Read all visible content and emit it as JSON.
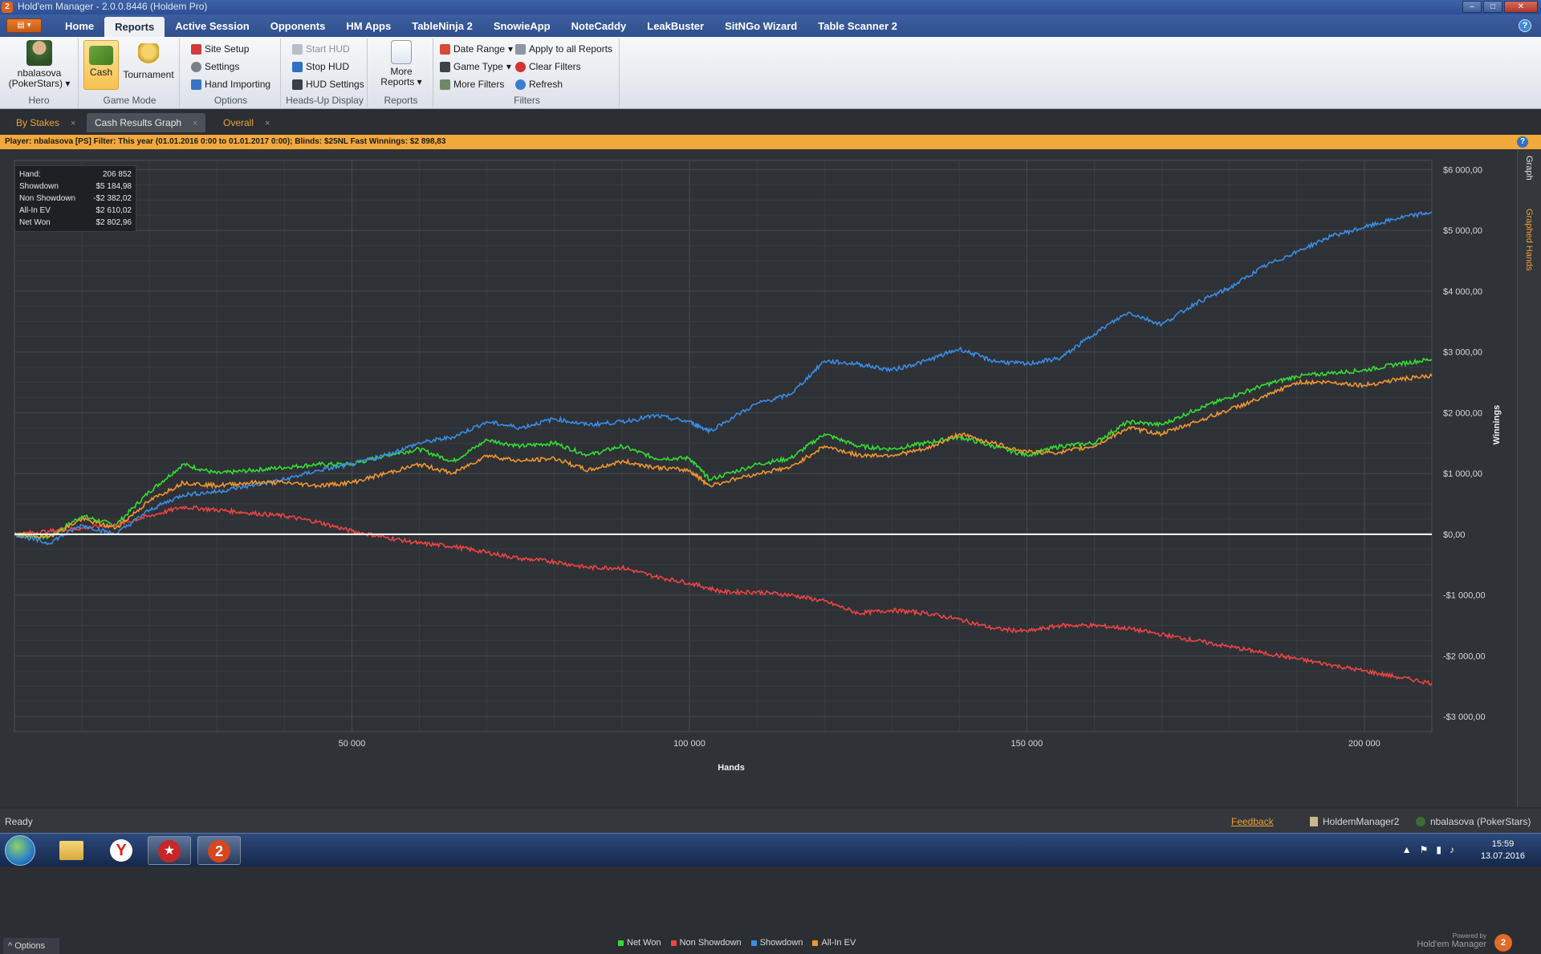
{
  "window": {
    "title": "Hold'em Manager - 2.0.0.8446 (Holdem Pro)"
  },
  "menu": {
    "tabs": [
      "Home",
      "Reports",
      "Active Session",
      "Opponents",
      "HM Apps",
      "TableNinja 2",
      "SnowieApp",
      "NoteCaddy",
      "LeakBuster",
      "SitNGo Wizard",
      "Table Scanner 2"
    ],
    "active": "Reports",
    "help": "?"
  },
  "ribbon": {
    "hero": {
      "name": "nbalasova",
      "site": "(PokerStars)",
      "label": "Hero"
    },
    "game_mode": {
      "cash": "Cash",
      "tournament": "Tournament",
      "label": "Game Mode"
    },
    "options": {
      "site_setup": "Site Setup",
      "settings": "Settings",
      "hand_importing": "Hand Importing",
      "label": "Options"
    },
    "hud": {
      "start": "Start HUD",
      "stop": "Stop HUD",
      "settings": "HUD Settings",
      "label": "Heads-Up Display"
    },
    "reports": {
      "more_line1": "More",
      "more_line2": "Reports",
      "label": "Reports"
    },
    "filters": {
      "date_range": "Date Range",
      "game_type": "Game Type",
      "more_filters": "More Filters",
      "apply_all": "Apply to all Reports",
      "clear": "Clear Filters",
      "refresh": "Refresh",
      "label": "Filters"
    }
  },
  "doc_tabs": [
    {
      "label": "By Stakes",
      "close": "×"
    },
    {
      "label": "Cash Results Graph",
      "close": "×"
    },
    {
      "label": "Overall",
      "close": "×"
    }
  ],
  "filter_bar": {
    "text": "Player:  nbalasova [PS]  Filter:  This year (01.01.2016 0:00 to 01.01.2017 0:00); Blinds: $25NL Fast  Winnings:  $2 898,83",
    "help": "?"
  },
  "stats": [
    {
      "label": "Hand:",
      "value": "206 852"
    },
    {
      "label": "Showdown",
      "value": "$5 184,98"
    },
    {
      "label": "Non Showdown",
      "value": "-$2 382,02"
    },
    {
      "label": "All-In EV",
      "value": "$2 610,02"
    },
    {
      "label": "Net Won",
      "value": "$2 802,96"
    }
  ],
  "side_panel": {
    "graph": "Graph",
    "graphed_hands": "Graphed Hands"
  },
  "options_button": "^ Options",
  "powered_by": {
    "small": "Powered by",
    "name": "Hold'em Manager",
    "logo": "2"
  },
  "status": {
    "ready": "Ready",
    "feedback": "Feedback",
    "database": "HoldemManager2",
    "player": "nbalasova (PokerStars)"
  },
  "taskbar": {
    "time": "15:59",
    "date": "13.07.2016"
  },
  "colors": {
    "net_won": "#33dd33",
    "non_showdown": "#ee4444",
    "showdown": "#3a8ee6",
    "all_in_ev": "#f0962e",
    "accent": "#f2a93b"
  },
  "chart_data": {
    "type": "line",
    "xlabel": "Hands",
    "ylabel": "Winnings",
    "xlim": [
      0,
      210000
    ],
    "ylim": [
      -3250,
      6150
    ],
    "x_ticks": [
      {
        "value": 50000,
        "label": "50 000"
      },
      {
        "value": 100000,
        "label": "100 000"
      },
      {
        "value": 150000,
        "label": "150 000"
      },
      {
        "value": 200000,
        "label": "200 000"
      }
    ],
    "y_ticks": [
      {
        "value": 6000,
        "label": "$6 000,00"
      },
      {
        "value": 5000,
        "label": "$5 000,00"
      },
      {
        "value": 4000,
        "label": "$4 000,00"
      },
      {
        "value": 3000,
        "label": "$3 000,00"
      },
      {
        "value": 2000,
        "label": "$2 000,00"
      },
      {
        "value": 1000,
        "label": "$1 000,00"
      },
      {
        "value": 0,
        "label": "$0,00"
      },
      {
        "value": -1000,
        "label": "-$1 000,00"
      },
      {
        "value": -2000,
        "label": "-$2 000,00"
      },
      {
        "value": -3000,
        "label": "-$3 000,00"
      }
    ],
    "legend_position": "bottom-center",
    "grid": true,
    "series": [
      {
        "name": "Net Won",
        "color": "#33dd33",
        "x": [
          0,
          5000,
          10000,
          15000,
          20000,
          25000,
          30000,
          35000,
          40000,
          45000,
          50000,
          55000,
          60000,
          65000,
          70000,
          75000,
          80000,
          85000,
          90000,
          95000,
          100000,
          103000,
          110000,
          115000,
          120000,
          125000,
          130000,
          135000,
          140000,
          145000,
          150000,
          155000,
          160000,
          165000,
          170000,
          175000,
          180000,
          185000,
          190000,
          195000,
          200000,
          205000,
          210000
        ],
        "y": [
          0,
          -50,
          300,
          150,
          700,
          1150,
          1000,
          1050,
          1100,
          1150,
          1150,
          1300,
          1400,
          1200,
          1550,
          1450,
          1500,
          1300,
          1450,
          1250,
          1250,
          900,
          1150,
          1250,
          1650,
          1450,
          1400,
          1500,
          1600,
          1450,
          1300,
          1450,
          1500,
          1850,
          1800,
          2050,
          2250,
          2450,
          2600,
          2650,
          2700,
          2800,
          2880
        ]
      },
      {
        "name": "Non Showdown",
        "color": "#ee4444",
        "x": [
          0,
          5000,
          10000,
          15000,
          20000,
          25000,
          30000,
          35000,
          40000,
          45000,
          50000,
          55000,
          60000,
          65000,
          70000,
          75000,
          80000,
          85000,
          90000,
          95000,
          100000,
          105000,
          110000,
          115000,
          120000,
          125000,
          130000,
          135000,
          140000,
          145000,
          150000,
          155000,
          160000,
          165000,
          170000,
          175000,
          180000,
          185000,
          190000,
          195000,
          200000,
          205000,
          210000
        ],
        "y": [
          0,
          50,
          100,
          150,
          300,
          450,
          400,
          350,
          300,
          200,
          50,
          -50,
          -150,
          -200,
          -300,
          -400,
          -450,
          -550,
          -550,
          -700,
          -800,
          -950,
          -950,
          -1000,
          -1100,
          -1300,
          -1250,
          -1300,
          -1400,
          -1550,
          -1600,
          -1500,
          -1500,
          -1550,
          -1650,
          -1750,
          -1850,
          -1950,
          -2050,
          -2150,
          -2250,
          -2350,
          -2450
        ]
      },
      {
        "name": "Showdown",
        "color": "#3a8ee6",
        "x": [
          0,
          5000,
          10000,
          15000,
          20000,
          25000,
          30000,
          35000,
          40000,
          45000,
          50000,
          55000,
          60000,
          65000,
          70000,
          75000,
          80000,
          85000,
          90000,
          95000,
          100000,
          103000,
          110000,
          115000,
          120000,
          125000,
          130000,
          135000,
          140000,
          145000,
          150000,
          155000,
          160000,
          165000,
          170000,
          175000,
          180000,
          185000,
          190000,
          195000,
          200000,
          205000,
          210000
        ],
        "y": [
          0,
          -150,
          150,
          0,
          400,
          650,
          700,
          800,
          900,
          1050,
          1150,
          1300,
          1500,
          1600,
          1850,
          1750,
          1900,
          1800,
          1850,
          1950,
          1850,
          1700,
          2150,
          2300,
          2850,
          2800,
          2700,
          2850,
          3050,
          2850,
          2800,
          2900,
          3300,
          3650,
          3450,
          3800,
          4050,
          4400,
          4650,
          4900,
          5050,
          5200,
          5300
        ]
      },
      {
        "name": "All-In EV",
        "color": "#f0962e",
        "x": [
          0,
          5000,
          10000,
          15000,
          20000,
          25000,
          30000,
          35000,
          40000,
          45000,
          50000,
          55000,
          60000,
          65000,
          70000,
          75000,
          80000,
          85000,
          90000,
          95000,
          100000,
          103000,
          110000,
          115000,
          120000,
          125000,
          130000,
          135000,
          140000,
          145000,
          150000,
          155000,
          160000,
          165000,
          170000,
          175000,
          180000,
          185000,
          190000,
          195000,
          200000,
          205000,
          210000
        ],
        "y": [
          0,
          -50,
          250,
          100,
          550,
          850,
          800,
          850,
          850,
          800,
          850,
          1000,
          1150,
          1000,
          1300,
          1200,
          1250,
          1050,
          1200,
          1100,
          1050,
          800,
          1000,
          1100,
          1450,
          1300,
          1300,
          1400,
          1650,
          1500,
          1350,
          1350,
          1450,
          1750,
          1650,
          1850,
          2050,
          2250,
          2500,
          2500,
          2450,
          2550,
          2600
        ]
      }
    ]
  }
}
